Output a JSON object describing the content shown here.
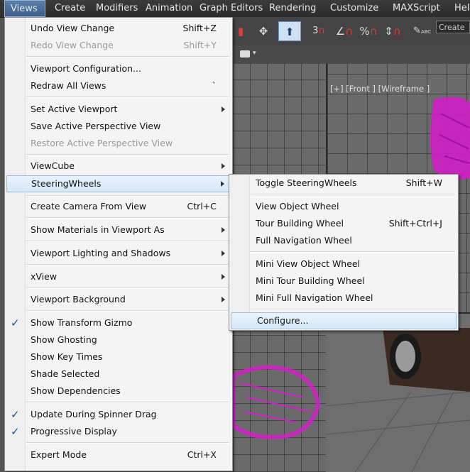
{
  "menubar": {
    "items": [
      {
        "label": "Views",
        "active": true
      },
      {
        "label": "Create"
      },
      {
        "label": "Modifiers"
      },
      {
        "label": "Animation"
      },
      {
        "label": "Graph Editors"
      },
      {
        "label": "Rendering"
      },
      {
        "label": "Customize"
      },
      {
        "label": "MAXScript"
      },
      {
        "label": "Hel"
      }
    ]
  },
  "toolbar": {
    "create_field": "Create",
    "snap_3": "3",
    "percent": "%",
    "abc": "ABC"
  },
  "viewport": {
    "front_label": "[+] [Front ] [Wireframe ]"
  },
  "main_menu": {
    "undo": {
      "label": "Undo View Change",
      "shortcut": "Shift+Z"
    },
    "redo": {
      "label": "Redo View Change",
      "shortcut": "Shift+Y"
    },
    "viewport_config": {
      "label": "Viewport Configuration..."
    },
    "redraw": {
      "label": "Redraw All Views",
      "shortcut": "`"
    },
    "set_active": {
      "label": "Set Active Viewport"
    },
    "save_persp": {
      "label": "Save Active Perspective View"
    },
    "restore_persp": {
      "label": "Restore Active Perspective View"
    },
    "viewcube": {
      "label": "ViewCube"
    },
    "steeringwheels": {
      "label": "SteeringWheels"
    },
    "create_camera": {
      "label": "Create Camera From View",
      "shortcut": "Ctrl+C"
    },
    "show_materials": {
      "label": "Show Materials in Viewport As"
    },
    "lighting": {
      "label": "Viewport Lighting and Shadows"
    },
    "xview": {
      "label": "xView"
    },
    "background": {
      "label": "Viewport Background"
    },
    "transform_gizmo": {
      "label": "Show Transform Gizmo",
      "checked": true
    },
    "ghosting": {
      "label": "Show Ghosting"
    },
    "key_times": {
      "label": "Show Key Times"
    },
    "shade_selected": {
      "label": "Shade Selected"
    },
    "dependencies": {
      "label": "Show Dependencies"
    },
    "spinner_drag": {
      "label": "Update During Spinner Drag",
      "checked": true
    },
    "progressive": {
      "label": "Progressive Display",
      "checked": true
    },
    "expert": {
      "label": "Expert Mode",
      "shortcut": "Ctrl+X"
    }
  },
  "sub_menu": {
    "toggle": {
      "label": "Toggle SteeringWheels",
      "shortcut": "Shift+W"
    },
    "view_object": {
      "label": "View Object Wheel"
    },
    "tour_building": {
      "label": "Tour Building Wheel",
      "shortcut": "Shift+Ctrl+J"
    },
    "full_nav": {
      "label": "Full Navigation Wheel"
    },
    "mini_view": {
      "label": "Mini View Object Wheel"
    },
    "mini_tour": {
      "label": "Mini Tour Building Wheel"
    },
    "mini_full": {
      "label": "Mini Full Navigation Wheel"
    },
    "configure": {
      "label": "Configure..."
    }
  },
  "colors": {
    "wireframe": "#d21fc8",
    "highlight": "#d6e7f7",
    "check": "#1a4fa8"
  }
}
